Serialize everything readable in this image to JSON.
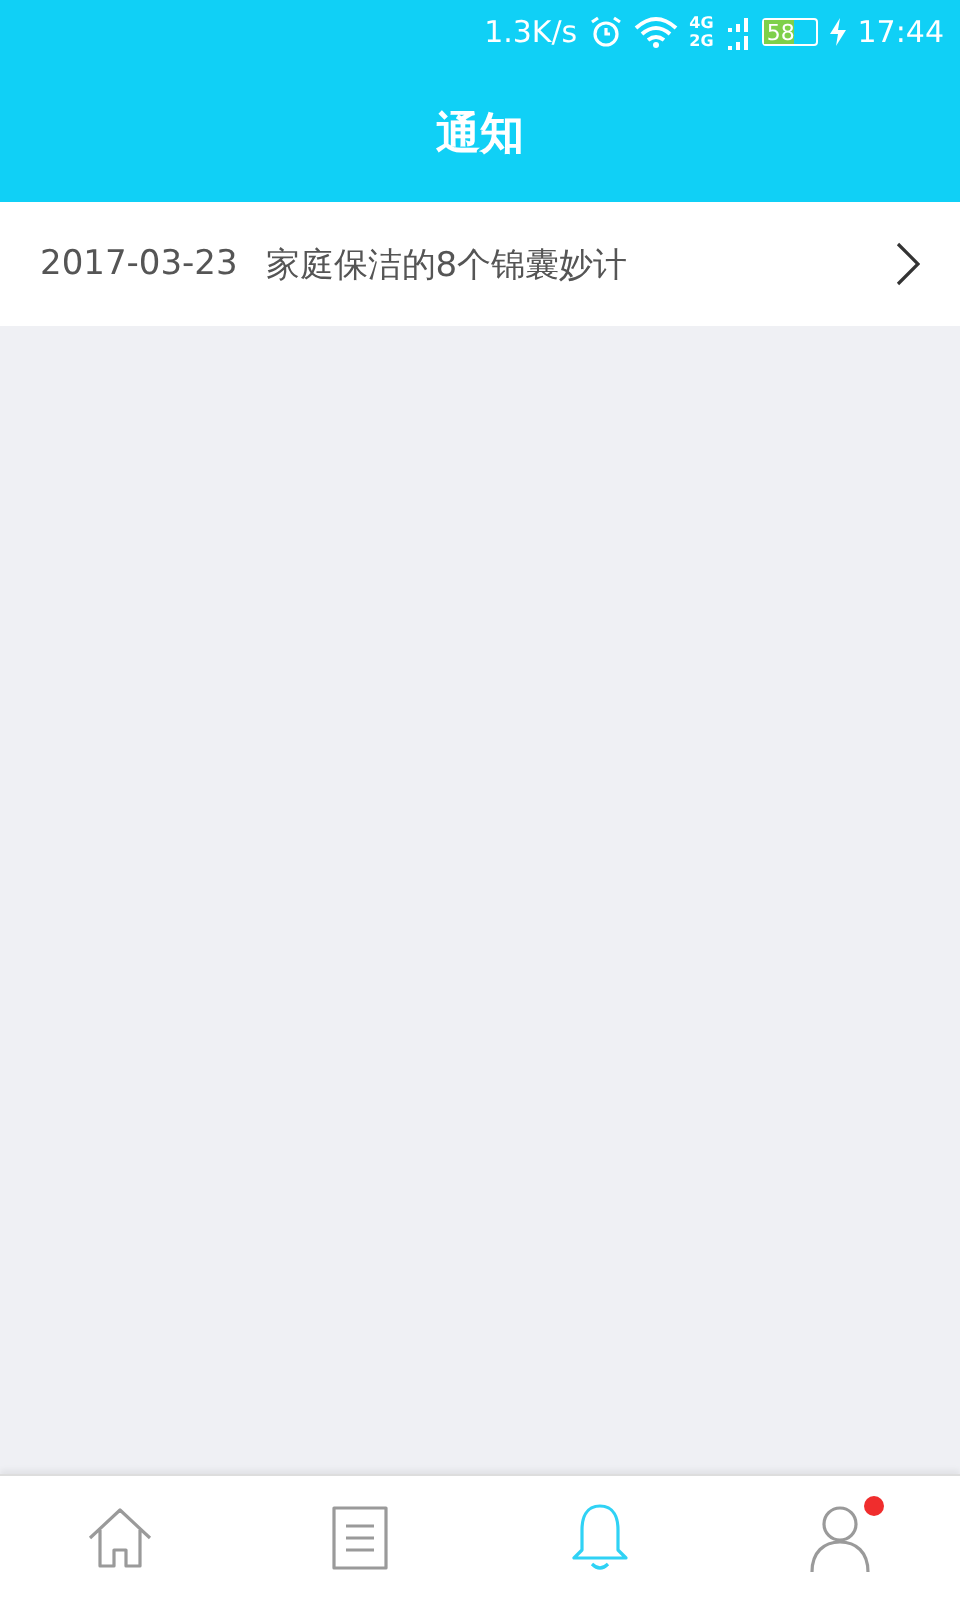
{
  "status_bar": {
    "speed": "1.3K/s",
    "network_top": "4G",
    "network_bottom": "2G",
    "battery": "58",
    "time": "17:44"
  },
  "header": {
    "title": "通知"
  },
  "notifications": [
    {
      "date": "2017-03-23",
      "title": "家庭保洁的8个锦囊妙计"
    }
  ],
  "tab_bar": [
    {
      "kind": "home",
      "selected": false,
      "badge": false
    },
    {
      "kind": "list",
      "selected": false,
      "badge": false
    },
    {
      "kind": "bell",
      "selected": true,
      "badge": false
    },
    {
      "kind": "person",
      "selected": false,
      "badge": true
    }
  ]
}
